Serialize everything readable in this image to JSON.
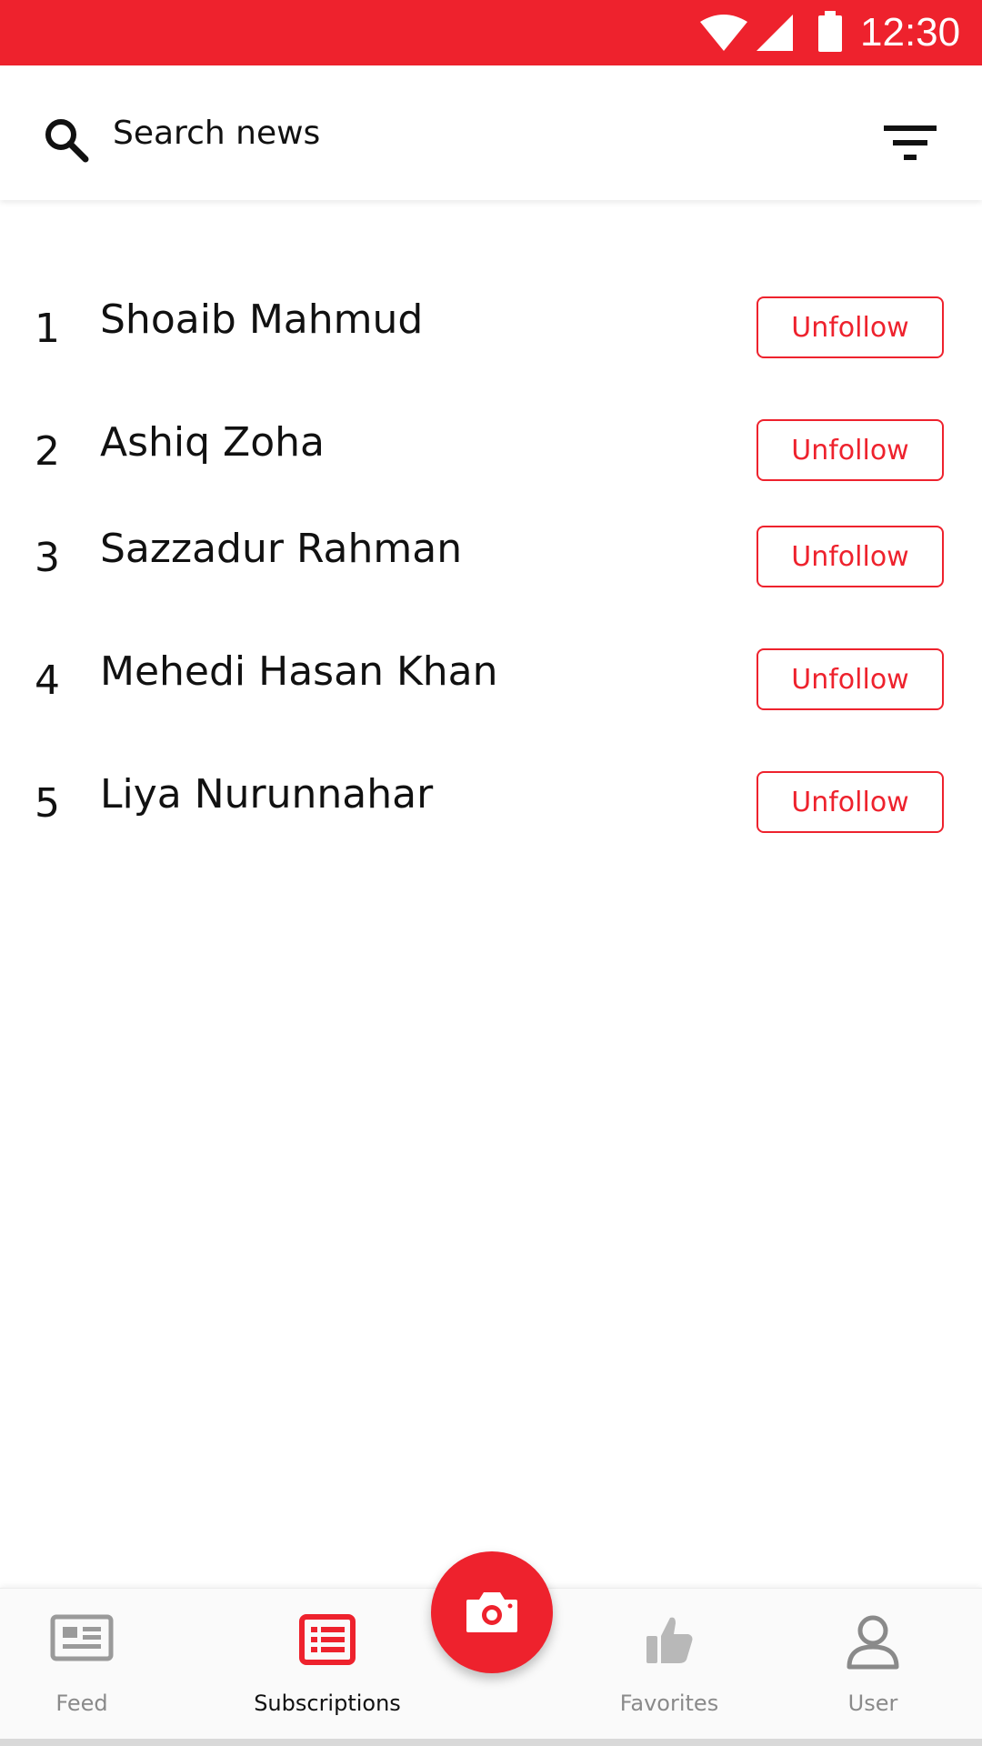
{
  "status_bar": {
    "time": "12:30",
    "icons": [
      "wifi-icon",
      "signal-icon",
      "battery-icon"
    ],
    "color": "#ee222d"
  },
  "search": {
    "placeholder": "Search news",
    "icons": [
      "search-icon",
      "filter-icon"
    ]
  },
  "subscriptions": [
    {
      "rank": "1",
      "name": "Shoaib Mahmud",
      "action": "Unfollow"
    },
    {
      "rank": "2",
      "name": "Ashiq Zoha",
      "action": "Unfollow"
    },
    {
      "rank": "3",
      "name": "Sazzadur Rahman",
      "action": "Unfollow"
    },
    {
      "rank": "4",
      "name": "Mehedi Hasan Khan",
      "action": "Unfollow"
    },
    {
      "rank": "5",
      "name": "Liya Nurunnahar",
      "action": "Unfollow"
    }
  ],
  "bottom_nav": {
    "items": [
      {
        "label": "Feed",
        "icon": "newspaper-icon",
        "active": false
      },
      {
        "label": "Subscriptions",
        "icon": "list-icon",
        "active": true
      },
      {
        "label": "Favorites",
        "icon": "thumbs-up-icon",
        "active": false
      },
      {
        "label": "User",
        "icon": "user-icon",
        "active": false
      }
    ],
    "fab_icon": "camera-icon"
  },
  "colors": {
    "accent": "#ee222d",
    "inactive": "#8a8a8a",
    "text": "#111111"
  }
}
